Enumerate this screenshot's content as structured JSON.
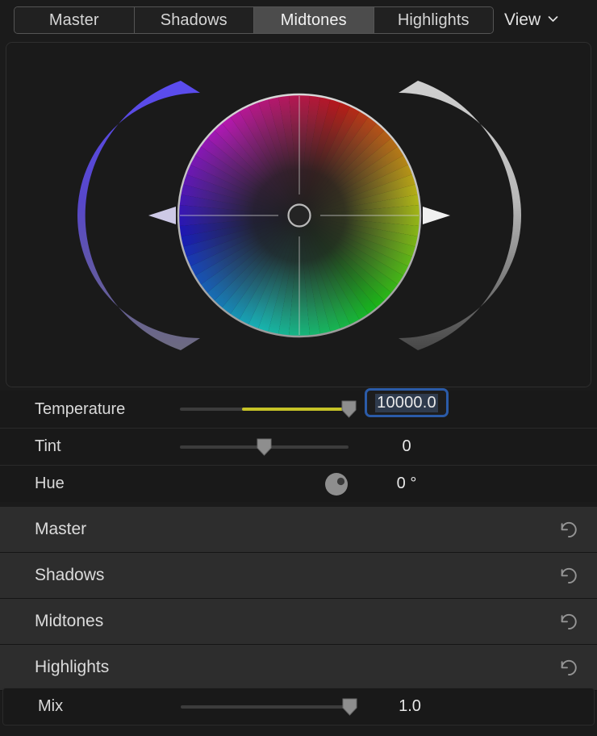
{
  "tabs": [
    {
      "label": "Master",
      "active": false
    },
    {
      "label": "Shadows",
      "active": false
    },
    {
      "label": "Midtones",
      "active": true
    },
    {
      "label": "Highlights",
      "active": false
    }
  ],
  "view_menu": {
    "label": "View",
    "icon": "chevron-down-icon"
  },
  "color_wheel": {
    "name": "midtones-color-wheel",
    "center_handle": "wheel-center-puck",
    "reset_icon": "reset-arrow-icon",
    "left_arc": {
      "name": "temperature-arc",
      "pointer": "left-arc-pointer",
      "color_from": "#5b4cf0",
      "color_to": "#6b6980"
    },
    "right_arc": {
      "name": "brightness-arc",
      "pointer": "right-arc-pointer",
      "color_from": "#c9c9c9",
      "color_to": "#4a4a4a"
    },
    "hues": {
      "top": "#b11f3b",
      "top_right": "#a01c9e",
      "right": "#2417b8",
      "bottom_right": "#0d9f9a",
      "bottom": "#12a04a",
      "left": "#8a8a16",
      "top_left": "#b0561a"
    }
  },
  "sliders": [
    {
      "name": "temperature",
      "label": "Temperature",
      "value": "10000.0",
      "thumb_pct": 100,
      "fill_pct": 100,
      "fill_from_pct": 37,
      "fill_color": "#c6c327",
      "field": true,
      "focused": true
    },
    {
      "name": "tint",
      "label": "Tint",
      "value": "0",
      "thumb_pct": 50,
      "fill_pct": 0,
      "fill_color": "#3c3c3c",
      "field": false
    },
    {
      "name": "hue",
      "label": "Hue",
      "value": "0 °",
      "dial": true,
      "dial_pct": 93,
      "field": false
    }
  ],
  "sections": [
    {
      "name": "master",
      "label": "Master",
      "reset_icon": "reset-arrow-icon"
    },
    {
      "name": "shadows",
      "label": "Shadows",
      "reset_icon": "reset-arrow-icon"
    },
    {
      "name": "midtones",
      "label": "Midtones",
      "reset_icon": "reset-arrow-icon"
    },
    {
      "name": "highlights",
      "label": "Highlights",
      "reset_icon": "reset-arrow-icon"
    }
  ],
  "mix": {
    "name": "mix",
    "label": "Mix",
    "value": "1.0",
    "thumb_pct": 100
  },
  "colors": {
    "panel_bg": "#1a1a1a",
    "window_bg": "#1b1b1b",
    "row_bg": "#191919",
    "section_bg": "#2d2d2d",
    "tab_active_bg": "#4c4c4c",
    "focus_ring": "#2b5ba8",
    "text": "#d8d8d8"
  }
}
